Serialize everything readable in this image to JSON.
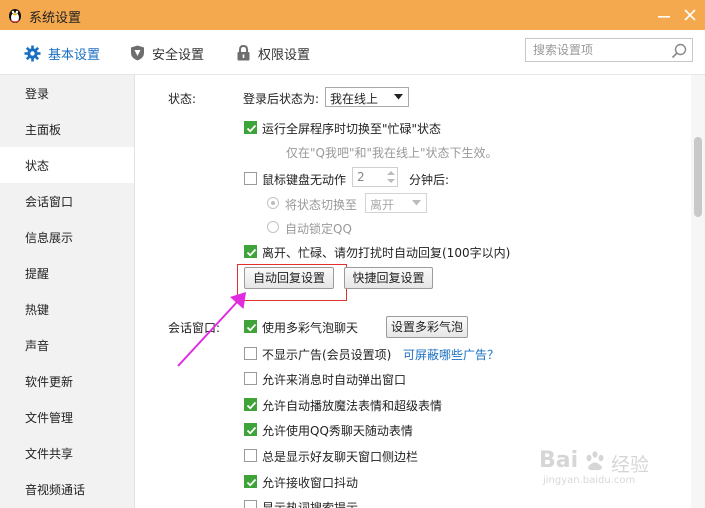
{
  "window": {
    "title": "系统设置"
  },
  "tabs": [
    {
      "label": "基本设置",
      "icon": "gear-icon",
      "active": true
    },
    {
      "label": "安全设置",
      "icon": "shield-icon",
      "active": false
    },
    {
      "label": "权限设置",
      "icon": "lock-icon",
      "active": false
    }
  ],
  "search": {
    "placeholder": "搜索设置项"
  },
  "sidebar": {
    "items": [
      {
        "label": "登录"
      },
      {
        "label": "主面板"
      },
      {
        "label": "状态",
        "active": true
      },
      {
        "label": "会话窗口"
      },
      {
        "label": "信息展示"
      },
      {
        "label": "提醒"
      },
      {
        "label": "热键"
      },
      {
        "label": "声音"
      },
      {
        "label": "软件更新"
      },
      {
        "label": "文件管理"
      },
      {
        "label": "文件共享"
      },
      {
        "label": "音视频通话"
      }
    ]
  },
  "status_section": {
    "label": "状态:",
    "login_status_label": "登录后状态为:",
    "login_status_value": "我在线上",
    "fullscreen_busy": {
      "label": "运行全屏程序时切换至\"忙碌\"状态",
      "checked": true
    },
    "fullscreen_hint": "仅在\"Q我吧\"和\"我在线上\"状态下生效。",
    "idle": {
      "label": "鼠标键盘无动作",
      "checked": false,
      "minutes": "2",
      "unit": "分钟后:"
    },
    "switch_status": {
      "label": "将状态切换至",
      "selected": true,
      "value": "离开"
    },
    "auto_lock": {
      "label": "自动锁定QQ",
      "selected": false
    },
    "auto_reply": {
      "label": "离开、忙碌、请勿打扰时自动回复(100字以内)",
      "checked": true
    },
    "auto_reply_button": "自动回复设置",
    "quick_reply_button": "快捷回复设置"
  },
  "chat_section": {
    "label": "会话窗口:",
    "bubble": {
      "label": "使用多彩气泡聊天",
      "checked": true
    },
    "bubble_button": "设置多彩气泡",
    "no_ads": {
      "label": "不显示广告(会员设置项)",
      "checked": false
    },
    "ads_link": "可屏蔽哪些广告？",
    "auto_popup": {
      "label": "允许来消息时自动弹出窗口",
      "checked": false
    },
    "magic_emoji": {
      "label": "允许自动播放魔法表情和超级表情",
      "checked": true
    },
    "qq_show": {
      "label": "允许使用QQ秀聊天随动表情",
      "checked": true
    },
    "sidebar_show": {
      "label": "总是显示好友聊天窗口侧边栏",
      "checked": false
    },
    "shake": {
      "label": "允许接收窗口抖动",
      "checked": true
    },
    "hotword": {
      "label": "显示热词搜索提示",
      "checked": false
    }
  },
  "watermark": {
    "brand": "Bai",
    "brand2": "经验",
    "url": "jingyan.baidu.com"
  },
  "colors": {
    "titlebar": "#f5a94e",
    "accent": "#1b6fc2",
    "check": "#3ea338",
    "highlight": "#e03030",
    "arrow": "#e22be0"
  }
}
